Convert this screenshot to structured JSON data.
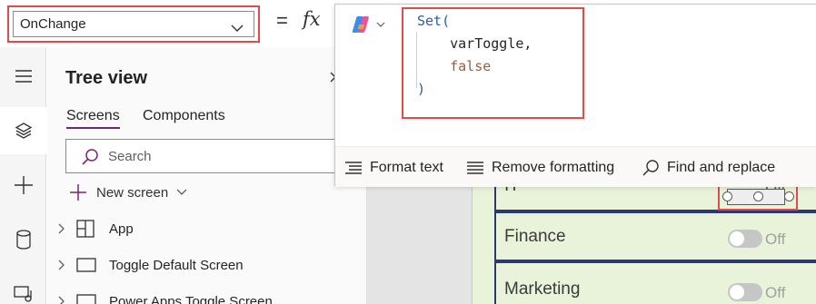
{
  "formula_bar": {
    "property_value": "OnChange",
    "equals": "=",
    "fx": "fx",
    "code": {
      "fn": "Set(",
      "arg1": "varToggle,",
      "arg2": "false",
      "close": ")"
    },
    "toolbar": {
      "format_text": "Format text",
      "remove_formatting": "Remove formatting",
      "find_replace": "Find and replace"
    }
  },
  "tree_view": {
    "title": "Tree view",
    "tabs": [
      {
        "label": "Screens",
        "active": true
      },
      {
        "label": "Components",
        "active": false
      }
    ],
    "search_placeholder": "Search",
    "new_screen": "New screen",
    "items": [
      {
        "label": "App",
        "icon": "app-grid-icon"
      },
      {
        "label": "Toggle Default Screen",
        "icon": "screen-icon"
      },
      {
        "label": "Power Apps Toggle Screen",
        "icon": "screen-icon"
      }
    ]
  },
  "canvas": {
    "rows": [
      {
        "label": "IT",
        "toggle_text": "Off"
      },
      {
        "label": "Finance",
        "toggle_text": "Off"
      },
      {
        "label": "Marketing",
        "toggle_text": "Off"
      }
    ]
  },
  "colors": {
    "highlight_red": "#e24b4b",
    "accent_purple": "#742774",
    "keyword_blue": "#2a5ea8",
    "value_brown": "#9b5d3a",
    "row_green": "#e8f3da",
    "row_border": "#2b3a6e"
  }
}
